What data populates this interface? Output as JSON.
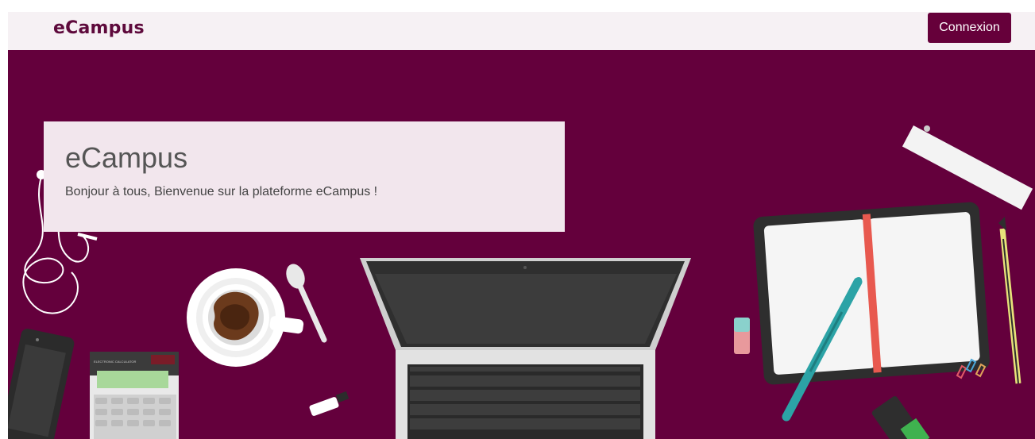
{
  "navbar": {
    "brand": "eCampus",
    "login_label": "Connexion"
  },
  "hero": {
    "title": "eCampus",
    "subtitle": "Bonjour à tous, Bienvenue sur la plateforme eCampus !"
  },
  "colors": {
    "brand": "#5e0a3c",
    "hero_background": "#64003c",
    "button": "#66003a",
    "navbar_background": "#f6f1f4",
    "heading_box": "#f2e6ed"
  },
  "illustration": {
    "calculator_label": "ELECTRONIC CALCULATOR",
    "objects": [
      "earphones-icon",
      "smartphone-icon",
      "calculator-icon",
      "coffee-cup-icon",
      "spoon-icon",
      "usb-drive-icon",
      "laptop-icon",
      "eraser-icon",
      "pen-icon",
      "notebook-icon",
      "ruler-icon",
      "pencil-icon",
      "paperclips-icon",
      "highlighter-icon"
    ]
  }
}
